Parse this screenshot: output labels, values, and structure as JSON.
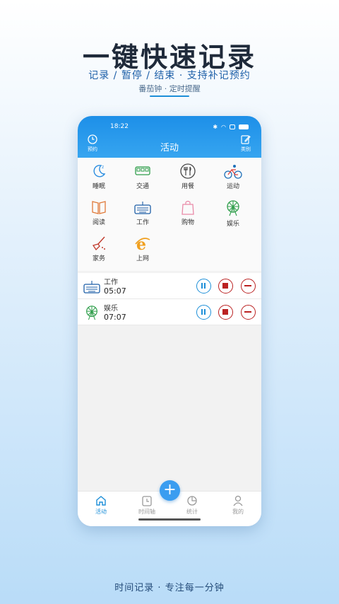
{
  "promo": {
    "headline": "一键快速记录",
    "subline": "记录 / 暂停 / 结束 · 支持补记预约",
    "subline2": "番茄钟 · 定时提醒",
    "footer": "时间记录 · 专注每一分钟"
  },
  "status": {
    "time": "18:22"
  },
  "header": {
    "title": "活动",
    "left_label": "预约",
    "right_label": "类别"
  },
  "categories": [
    {
      "label": "睡眠",
      "icon": "moon-icon",
      "color": "#2a8de0"
    },
    {
      "label": "交通",
      "icon": "bus-icon",
      "color": "#2e9e4a"
    },
    {
      "label": "用餐",
      "icon": "cutlery-icon",
      "color": "#444444"
    },
    {
      "label": "运动",
      "icon": "bicycle-icon",
      "color": "#1d6fb8"
    },
    {
      "label": "阅读",
      "icon": "book-icon",
      "color": "#e07a3a"
    },
    {
      "label": "工作",
      "icon": "keyboard-icon",
      "color": "#1d5fa8"
    },
    {
      "label": "购物",
      "icon": "shopping-bag-icon",
      "color": "#e98aa8"
    },
    {
      "label": "娱乐",
      "icon": "ferris-wheel-icon",
      "color": "#2e9e4a"
    },
    {
      "label": "家务",
      "icon": "broom-icon",
      "color": "#c0392b"
    },
    {
      "label": "上网",
      "icon": "ie-browser-icon",
      "color": "#f0a020"
    }
  ],
  "records": [
    {
      "name": "工作",
      "time": "05:07",
      "icon": "keyboard-icon"
    },
    {
      "name": "娱乐",
      "time": "07:07",
      "icon": "ferris-wheel-icon"
    }
  ],
  "tabs": [
    {
      "label": "活动",
      "icon": "home-icon",
      "active": true
    },
    {
      "label": "时间轴",
      "icon": "timeline-icon",
      "active": false
    },
    {
      "label": "统计",
      "icon": "pie-chart-icon",
      "active": false
    },
    {
      "label": "我的",
      "icon": "user-icon",
      "active": false
    }
  ],
  "fab": {
    "label": "+"
  }
}
